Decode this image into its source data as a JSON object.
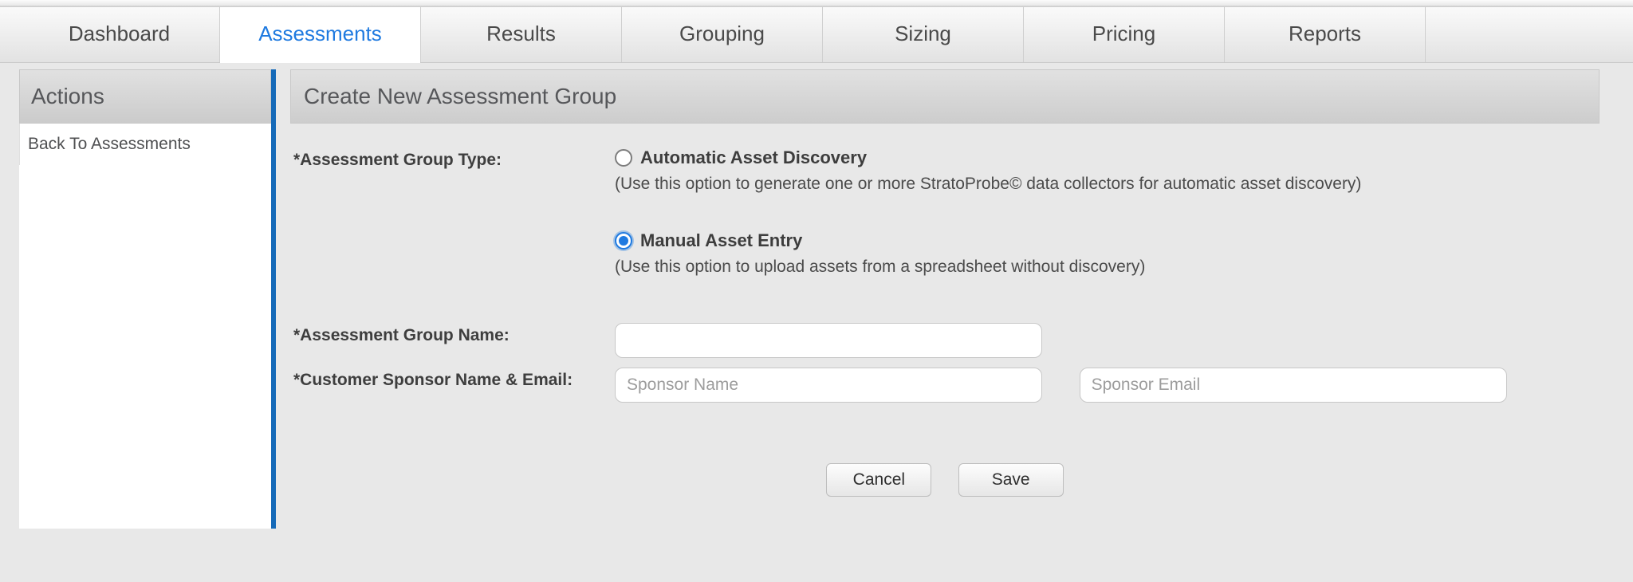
{
  "tabs": [
    {
      "label": "Dashboard",
      "active": false
    },
    {
      "label": "Assessments",
      "active": true
    },
    {
      "label": "Results",
      "active": false
    },
    {
      "label": "Grouping",
      "active": false
    },
    {
      "label": "Sizing",
      "active": false
    },
    {
      "label": "Pricing",
      "active": false
    },
    {
      "label": "Reports",
      "active": false
    }
  ],
  "sidebar": {
    "header": "Actions",
    "back_link": "Back To Assessments"
  },
  "main": {
    "title": "Create New Assessment Group",
    "group_type_label": "*Assessment Group Type:",
    "radio_auto": {
      "label": "Automatic Asset Discovery",
      "help": "(Use this option to generate one or more StratoProbe© data collectors for automatic asset discovery)",
      "checked": false
    },
    "radio_manual": {
      "label": "Manual Asset Entry",
      "help": "(Use this option to upload assets from a spreadsheet without discovery)",
      "checked": true
    },
    "group_name_label": "*Assessment Group Name:",
    "group_name_value": "",
    "sponsor_label": "*Customer Sponsor Name & Email:",
    "sponsor_name_placeholder": "Sponsor Name",
    "sponsor_name_value": "",
    "sponsor_email_placeholder": "Sponsor Email",
    "sponsor_email_value": "",
    "cancel_label": "Cancel",
    "save_label": "Save"
  }
}
